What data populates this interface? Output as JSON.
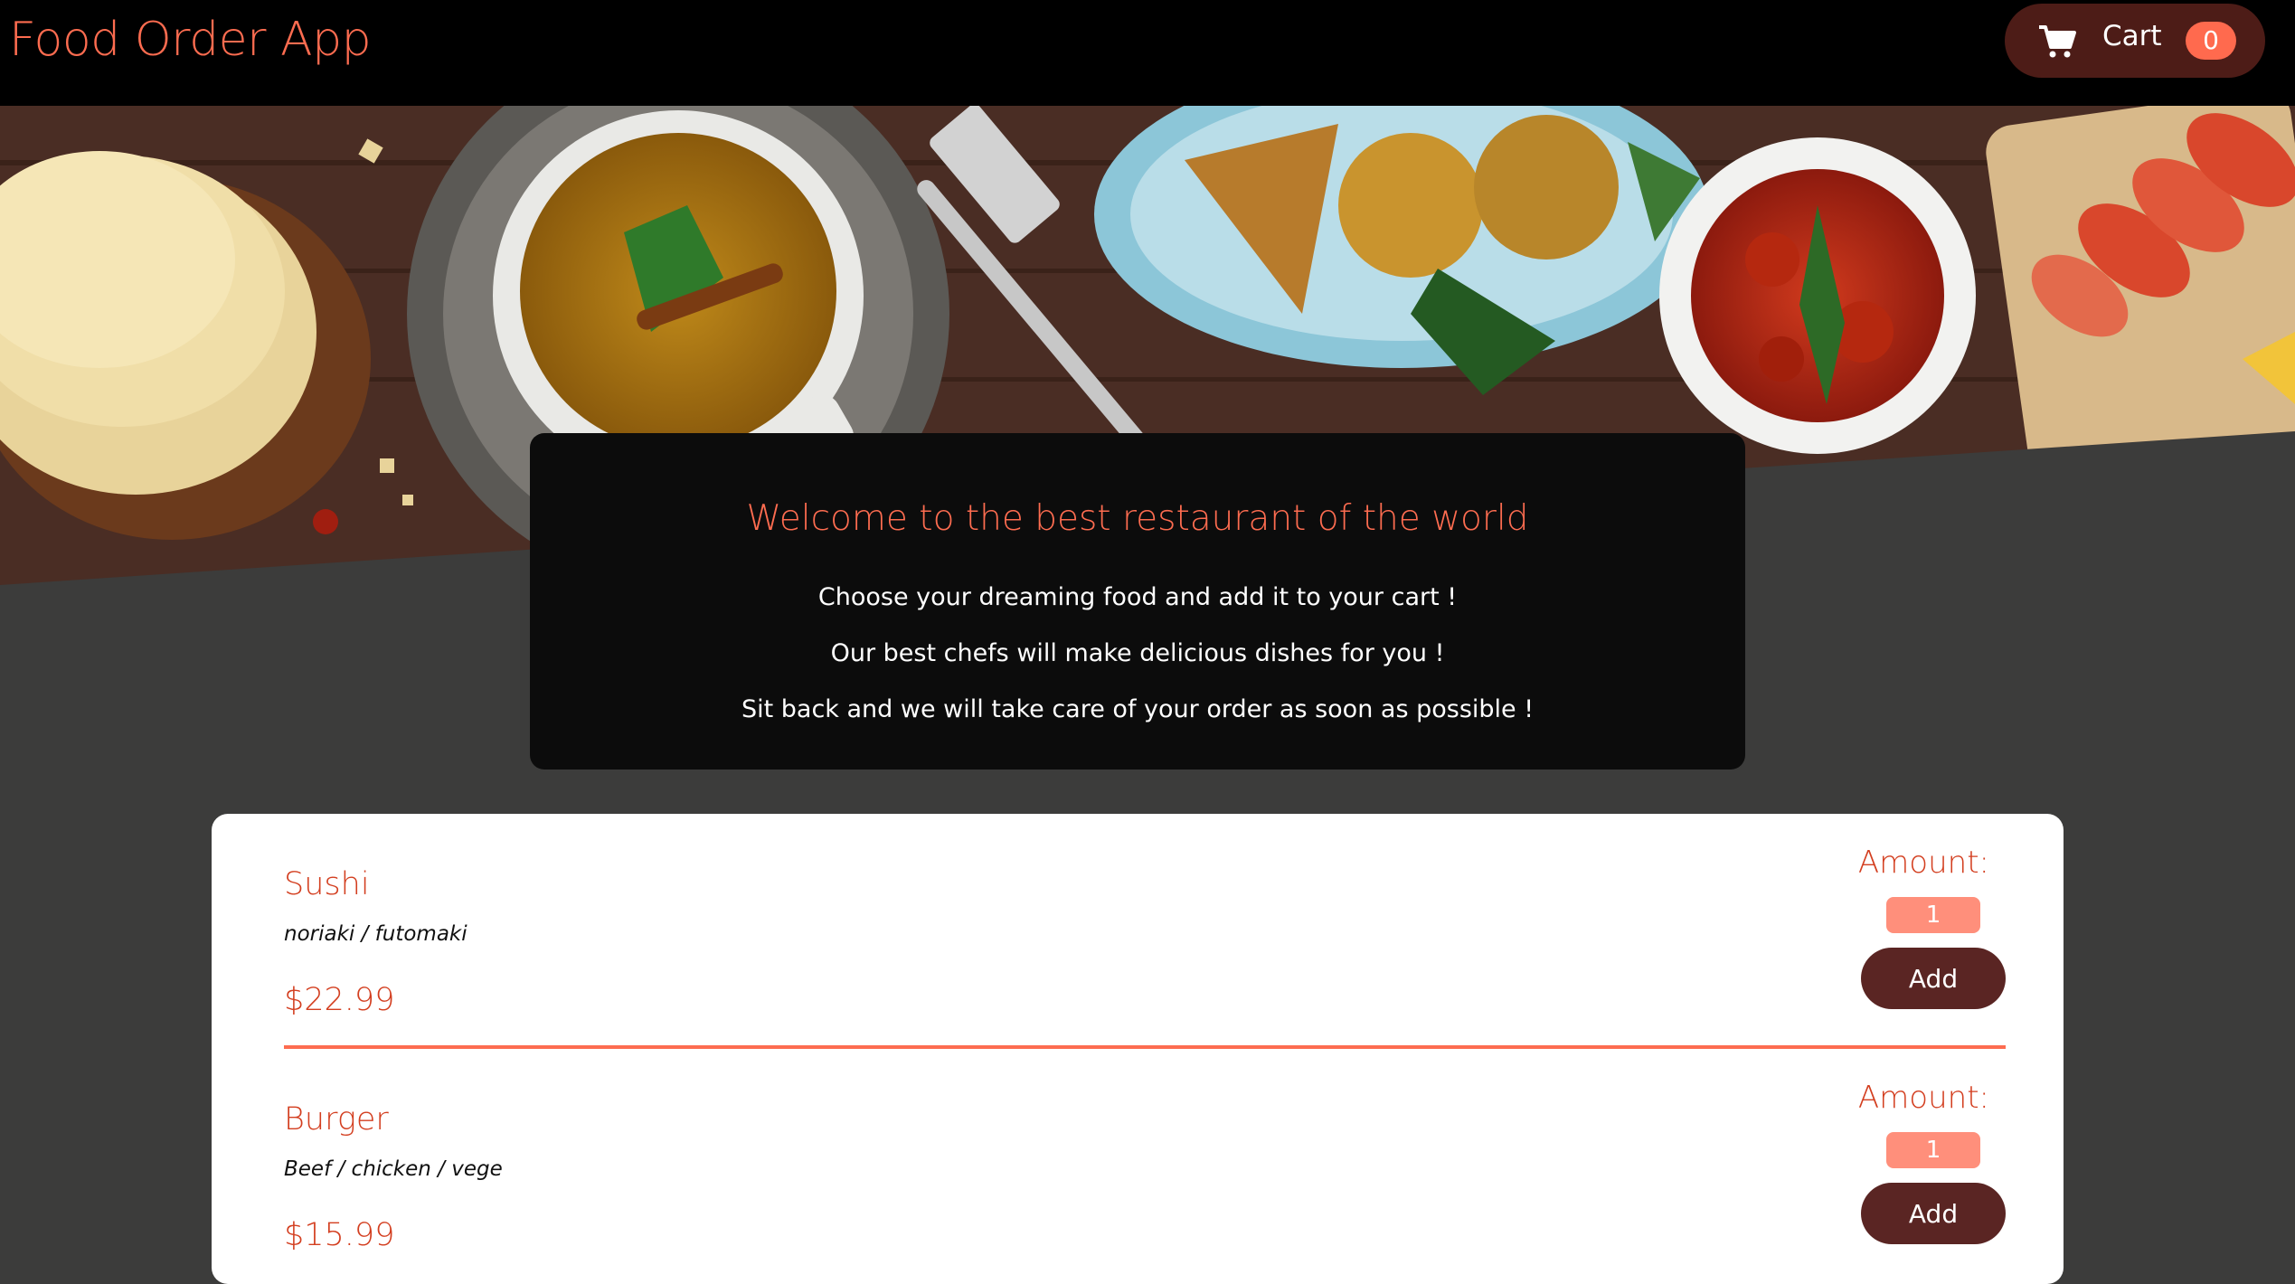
{
  "header": {
    "title": "Food Order App",
    "cart": {
      "label": "Cart",
      "count": "0",
      "icon": "cart-icon"
    }
  },
  "hero": {
    "image": "food-banner-image"
  },
  "summary": {
    "title": "Welcome to the best restaurant of the world",
    "lines": [
      "Choose your dreaming food and add it to your cart !",
      "Our best chefs will make delicious dishes for you !",
      "Sit back and we will take care of your order as soon as possible !"
    ]
  },
  "meals": [
    {
      "name": "Sushi",
      "description": "noriaki / futomaki",
      "price": "$22.99",
      "amount_label": "Amount:",
      "amount_value": "1",
      "add_label": "Add"
    },
    {
      "name": "Burger",
      "description": "Beef / chicken / vege",
      "price": "$15.99",
      "amount_label": "Amount:",
      "amount_value": "1",
      "add_label": "Add"
    }
  ],
  "colors": {
    "header_bg": "#000000",
    "accent": "#fd6c50",
    "meal_text": "#d33e1f",
    "button_brown": "#5a2523",
    "cart_bg": "#4d1c17",
    "page_bg": "#3c3c3b"
  }
}
